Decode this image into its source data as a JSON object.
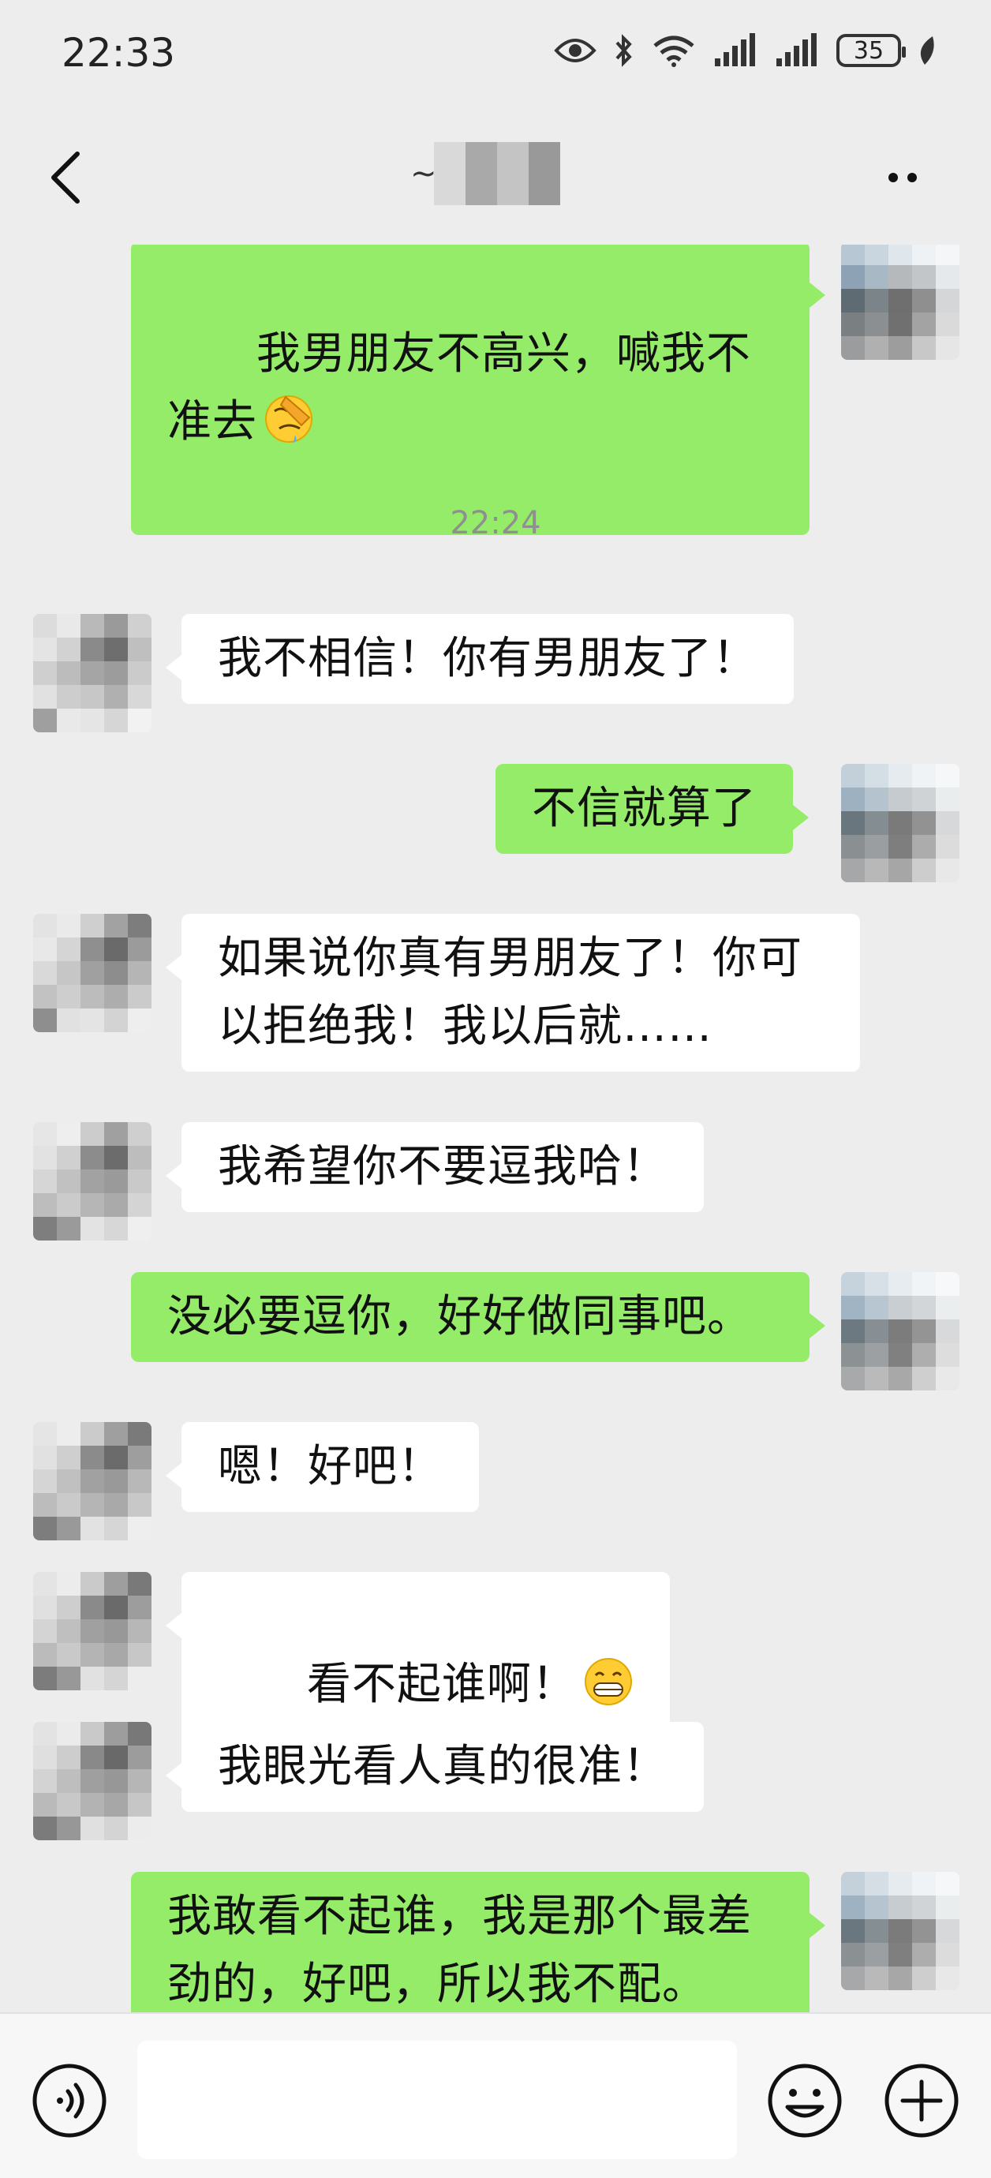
{
  "status_bar": {
    "time": "22:33",
    "battery": "35",
    "icons": [
      "eye-icon",
      "bluetooth-icon",
      "wifi-icon",
      "signal-icon",
      "signal-icon",
      "battery-icon",
      "leaf-icon"
    ]
  },
  "header": {
    "contact_name_visible": "~",
    "icons": [
      "back-icon",
      "more-icon"
    ]
  },
  "chat": {
    "messages": [
      {
        "from": "me",
        "text": "我男朋友不高兴，喊我不准去",
        "trailing_emoji": "facepalm-emoji"
      },
      {
        "from": "other",
        "text": "我不相信！你有男朋友了！"
      },
      {
        "from": "me",
        "text": "不信就算了"
      },
      {
        "from": "other",
        "text": "如果说你真有男朋友了！你可以拒绝我！我以后就……"
      },
      {
        "from": "other",
        "text": "我希望你不要逗我哈！"
      },
      {
        "from": "me",
        "text": "没必要逗你，好好做同事吧。"
      },
      {
        "from": "other",
        "text": "嗯！好吧！"
      },
      {
        "from": "other",
        "text": "看不起谁啊！",
        "trailing_emoji": "grin-emoji"
      },
      {
        "from": "other",
        "text": "我眼光看人真的很准！"
      },
      {
        "from": "me",
        "text": "我敢看不起谁，我是那个最差劲的，好吧，所以我不配。"
      }
    ],
    "timestamp": "22:24"
  },
  "input_bar": {
    "value": "",
    "placeholder": "",
    "icons": [
      "voice-icon",
      "emoji-icon",
      "plus-icon"
    ]
  },
  "colors": {
    "background": "#ededed",
    "my_bubble": "#95ec69",
    "their_bubble": "#ffffff",
    "timestamp": "#8f8f8f"
  }
}
